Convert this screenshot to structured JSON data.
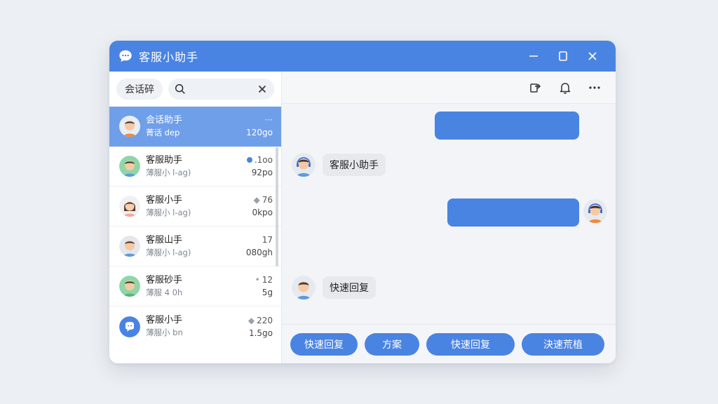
{
  "window": {
    "title": "客服小助手",
    "accent": "#4a84e2"
  },
  "sidebar": {
    "filter_label": "会话碎",
    "search_placeholder": "",
    "conversations": [
      {
        "name": "会话助手",
        "preview": "菁话 dep",
        "meta": "···",
        "time": "120go",
        "active": true,
        "avatar": "boy-orange"
      },
      {
        "name": "客服助手",
        "preview": "薄服小 l-ag)",
        "meta": ".1oo",
        "time": "92po",
        "dot": true,
        "avatar": "boy-green"
      },
      {
        "name": "客服小手",
        "preview": "薄服小 l-ag)",
        "meta": "76",
        "time": "0kpo",
        "avatar": "girl"
      },
      {
        "name": "客服山手",
        "preview": "薄服小 l-ag)",
        "meta": "17",
        "time": "080gh",
        "avatar": "boy-gray"
      },
      {
        "name": "客服砂手",
        "preview": "薄服 4 0h",
        "meta": "12",
        "time": "5g",
        "avatar": "boy-green2"
      },
      {
        "name": "客服小手",
        "preview": "薄服小 bn",
        "meta": "220",
        "time": "1.5go",
        "avatar": "blue-logo"
      }
    ]
  },
  "chat": {
    "messages": [
      {
        "from": "agent",
        "text": "客服小助手"
      },
      {
        "from": "agent",
        "text": "快速回复"
      }
    ],
    "quick_replies": [
      "快速回复",
      "方案",
      "快速回复",
      "決速荒植"
    ]
  },
  "icons": {
    "logo": "chat-bubble-icon",
    "minimize": "minimize-icon",
    "maximize": "maximize-icon",
    "close": "close-icon",
    "search": "search-icon",
    "clear": "clear-icon",
    "transfer": "transfer-icon",
    "bell": "bell-icon",
    "more": "more-icon"
  }
}
